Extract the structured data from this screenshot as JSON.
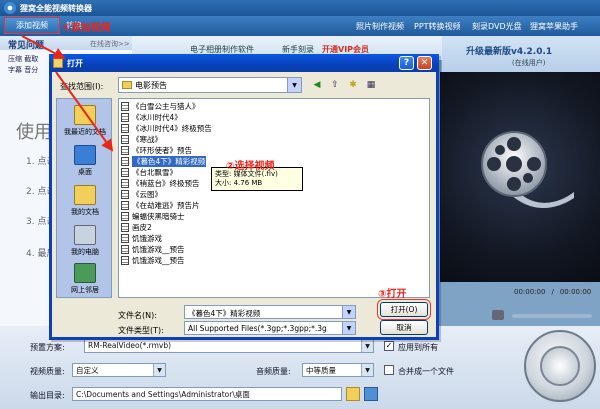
{
  "app": {
    "title": "狸窝全能视频转换器",
    "menu": {
      "add_video": "添加视频",
      "convert": "转换"
    },
    "header_links": [
      "照片制作视频",
      "PPT转换视频",
      "刻录DVD光盘",
      "狸窝苹果助手"
    ],
    "faq": {
      "title": "常见问题",
      "online": "在线咨询>>",
      "rows": [
        "压缩 截取",
        "字幕 音分"
      ]
    },
    "usage": {
      "heading": "使用",
      "steps": [
        "1. 点击",
        "2. 点击",
        "3. 点击",
        "4. 最后"
      ]
    },
    "banner": {
      "link1": "电子相册制作软件",
      "link2": "新手刻录",
      "vip": "开通VIP会员"
    },
    "upgrade": {
      "version": "升级最新版v4.2.0.1",
      "status": "(在线用户)"
    },
    "time": {
      "current": "00:00:00",
      "total": "00:00:00"
    }
  },
  "bottom": {
    "preset_label": "预置方案:",
    "preset_value": "RM-RealVideo(*.rmvb)",
    "apply_all_label": "应用到所有",
    "video_quality_label": "视频质量:",
    "video_quality_value": "自定义",
    "audio_quality_label": "音频质量:",
    "audio_quality_value": "中等质量",
    "merge_label": "合并成一个文件",
    "output_label": "输出目录:",
    "output_value": "C:\\Documents and Settings\\Administrator\\桌面"
  },
  "dialog": {
    "title": "打开",
    "lookin_label": "查找范围(I):",
    "lookin_value": "电影预告",
    "places": [
      "我最近的文档",
      "桌面",
      "我的文档",
      "我的电脑",
      "网上邻居"
    ],
    "files": [
      "《白雪公主与猎人》",
      "《冰川时代4》",
      "《冰川时代4》终极预告",
      "《寒战》",
      "《环形使者》预告",
      "《暮色4下》精彩视频",
      "《台北飘雪》",
      "《稍蓝台》终极预告",
      "《云图》",
      "《在劫难逃》预告片",
      "蝙蝠侠黑暗骑士",
      "画皮2",
      "饥饿游戏",
      "饥饿游戏__预告",
      "饥饿游戏__预告"
    ],
    "selected_index": 5,
    "tooltip": {
      "type": "类型: 媒体文件(.flv)",
      "size": "大小: 4.76 MB"
    },
    "filename_label": "文件名(N):",
    "filename_value": "《暮色4下》精彩视频",
    "filetype_label": "文件类型(T):",
    "filetype_value": "All Supported Files(*.3gp;*.3gpp;*.3g",
    "open_label": "打开(O)",
    "cancel_label": "取消"
  },
  "annotations": {
    "a1": "①添加视频",
    "a2": "②选择视频",
    "a3": "③打开"
  },
  "colors": {
    "annotation": "#e8261b",
    "titlebar": "#0a58e6",
    "selection": "#316ac5"
  }
}
